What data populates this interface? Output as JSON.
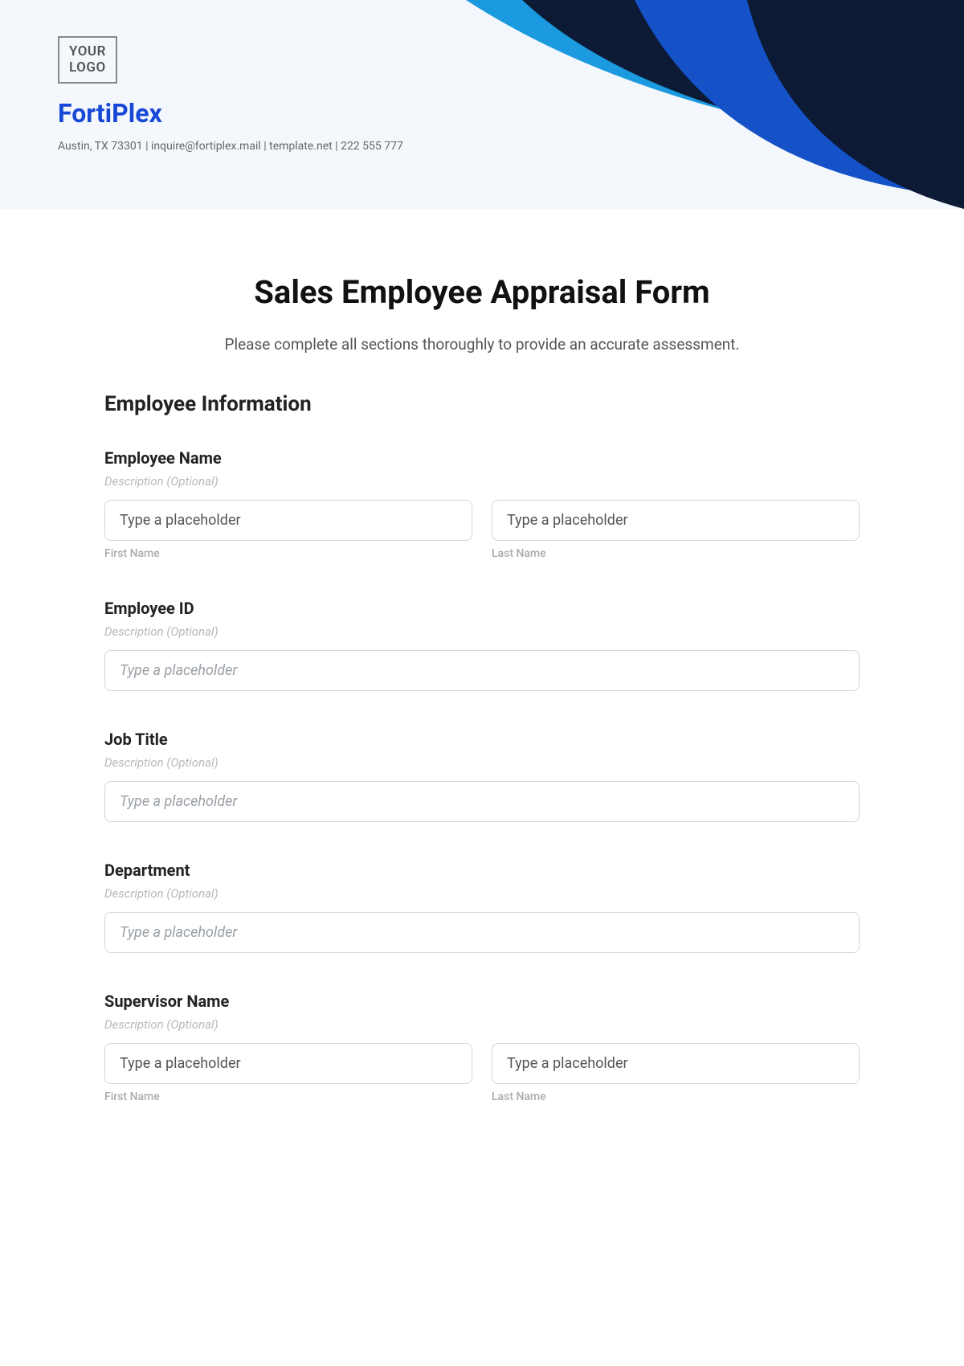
{
  "header": {
    "logo_text": "YOUR\nLOGO",
    "company_name": "FortiPlex",
    "contact_line": "Austin, TX 73301 | inquire@fortiplex.mail | template.net | 222 555 777"
  },
  "page": {
    "title": "Sales Employee Appraisal Form",
    "intro": "Please complete all sections thoroughly to provide an accurate assessment."
  },
  "section": {
    "heading": "Employee Information"
  },
  "fields": {
    "employee_name": {
      "label": "Employee Name",
      "description": "Description (Optional)",
      "first_placeholder": "Type a placeholder",
      "last_placeholder": "Type a placeholder",
      "first_sub": "First Name",
      "last_sub": "Last Name"
    },
    "employee_id": {
      "label": "Employee ID",
      "description": "Description (Optional)",
      "placeholder": "Type a placeholder"
    },
    "job_title": {
      "label": "Job Title",
      "description": "Description (Optional)",
      "placeholder": "Type a placeholder"
    },
    "department": {
      "label": "Department",
      "description": "Description (Optional)",
      "placeholder": "Type a placeholder"
    },
    "supervisor_name": {
      "label": "Supervisor Name",
      "description": "Description (Optional)",
      "first_placeholder": "Type a placeholder",
      "last_placeholder": "Type a placeholder",
      "first_sub": "First Name",
      "last_sub": "Last Name"
    }
  }
}
